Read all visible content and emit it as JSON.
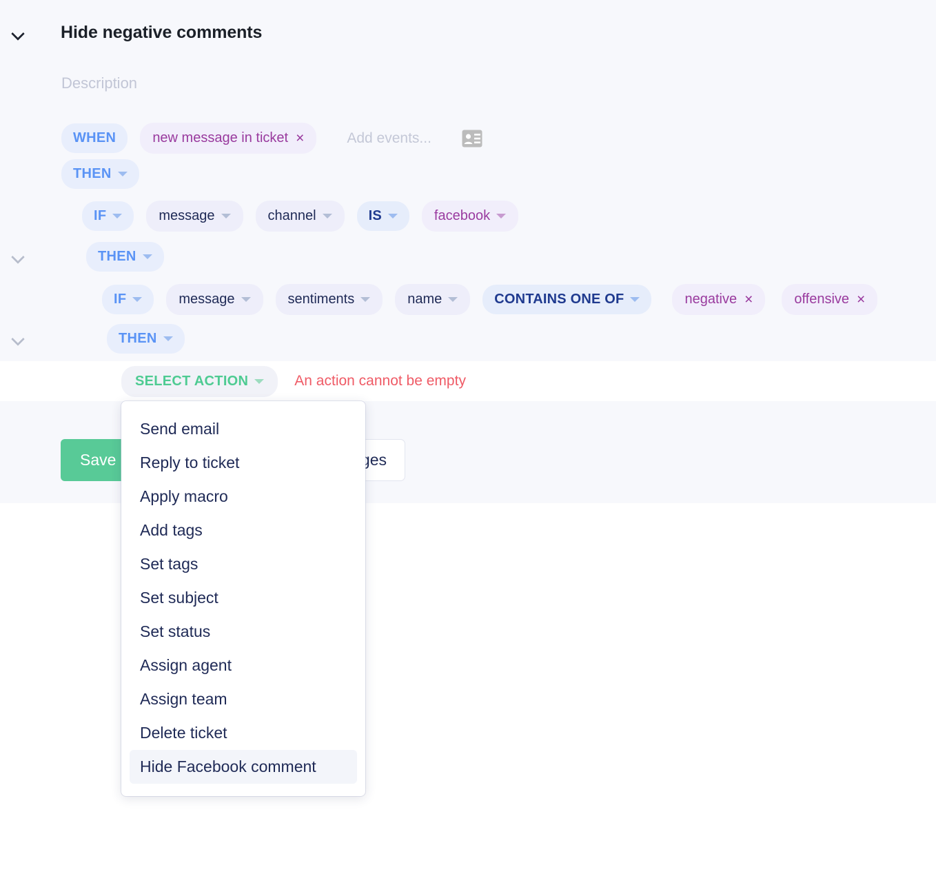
{
  "rule": {
    "title": "Hide negative comments",
    "description_placeholder": "Description",
    "collapse_icon": "chevron-down-icon"
  },
  "when_row": {
    "keyword": "WHEN",
    "event_chip": "new message in ticket",
    "event_remove": "×",
    "add_events_placeholder": "Add events...",
    "contact_icon": "contact-card-icon"
  },
  "then_row_1": {
    "keyword": "THEN"
  },
  "condition_1": {
    "keyword": "IF",
    "entity": "message",
    "attribute": "channel",
    "operator": "IS",
    "value": "facebook"
  },
  "then_row_2": {
    "keyword": "THEN"
  },
  "condition_2": {
    "keyword": "IF",
    "entity": "message",
    "attribute": "sentiments",
    "subattribute": "name",
    "operator": "CONTAINS ONE OF",
    "values": [
      {
        "label": "negative",
        "remove": "×"
      },
      {
        "label": "offensive",
        "remove": "×"
      }
    ]
  },
  "then_row_3": {
    "keyword": "THEN"
  },
  "action_row": {
    "select_action_label": "SELECT ACTION",
    "error": "An action cannot be empty"
  },
  "footer": {
    "save_label": "Save",
    "discard_label": "Discard changes"
  },
  "action_dropdown": {
    "items": [
      {
        "label": "Send email",
        "selected": false
      },
      {
        "label": "Reply to ticket",
        "selected": false
      },
      {
        "label": "Apply macro",
        "selected": false
      },
      {
        "label": "Add tags",
        "selected": false
      },
      {
        "label": "Set tags",
        "selected": false
      },
      {
        "label": "Set subject",
        "selected": false
      },
      {
        "label": "Set status",
        "selected": false
      },
      {
        "label": "Assign agent",
        "selected": false
      },
      {
        "label": "Assign team",
        "selected": false
      },
      {
        "label": "Delete ticket",
        "selected": false
      },
      {
        "label": "Hide Facebook comment",
        "selected": true
      }
    ]
  },
  "colors": {
    "panel_bg": "#f7f8fc",
    "keyword_chip_bg": "#e8eefc",
    "keyword_chip_text": "#5a93f5",
    "field_chip_bg": "#eeeefa",
    "field_chip_text": "#1f2a56",
    "value_chip_bg": "#f1eefb",
    "value_chip_text": "#993a9e",
    "accent_green": "#58ca97",
    "error_red": "#ef5b66"
  }
}
